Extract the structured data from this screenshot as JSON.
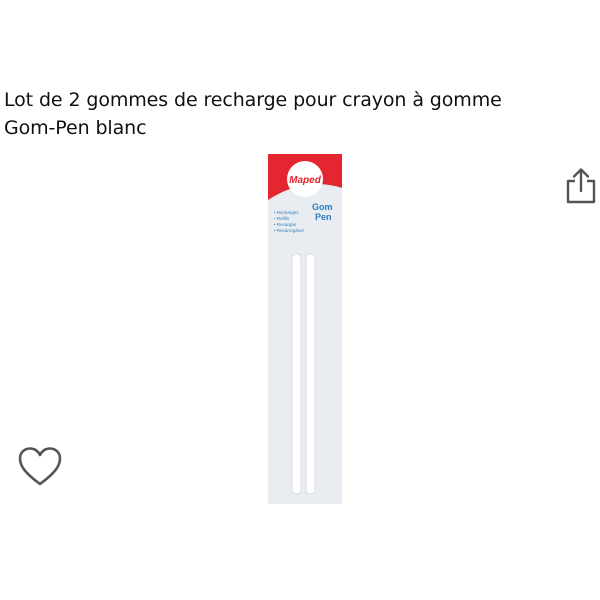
{
  "product": {
    "title_line1": "Lot de 2 gommes de recharge pour crayon à  gomme",
    "title_line2": "Gom-Pen blanc",
    "image_alt": "Maped Gom Pen eraser refills pack",
    "package": {
      "brand": "Maped",
      "product_name_1": "Gom",
      "product_name_2": "Pen",
      "features": [
        "• Recharges",
        "• Refills",
        "• Recargas",
        "• Recarregável"
      ]
    }
  },
  "actions": {
    "share_icon": "share-icon",
    "wishlist_icon": "heart-outline-icon"
  },
  "colors": {
    "title_text": "#0f1111",
    "icon_stroke": "#555555",
    "brand_red": "#e3262f",
    "brand_blue": "#2a7fc0",
    "packaging_bg": "#e9edf1"
  }
}
